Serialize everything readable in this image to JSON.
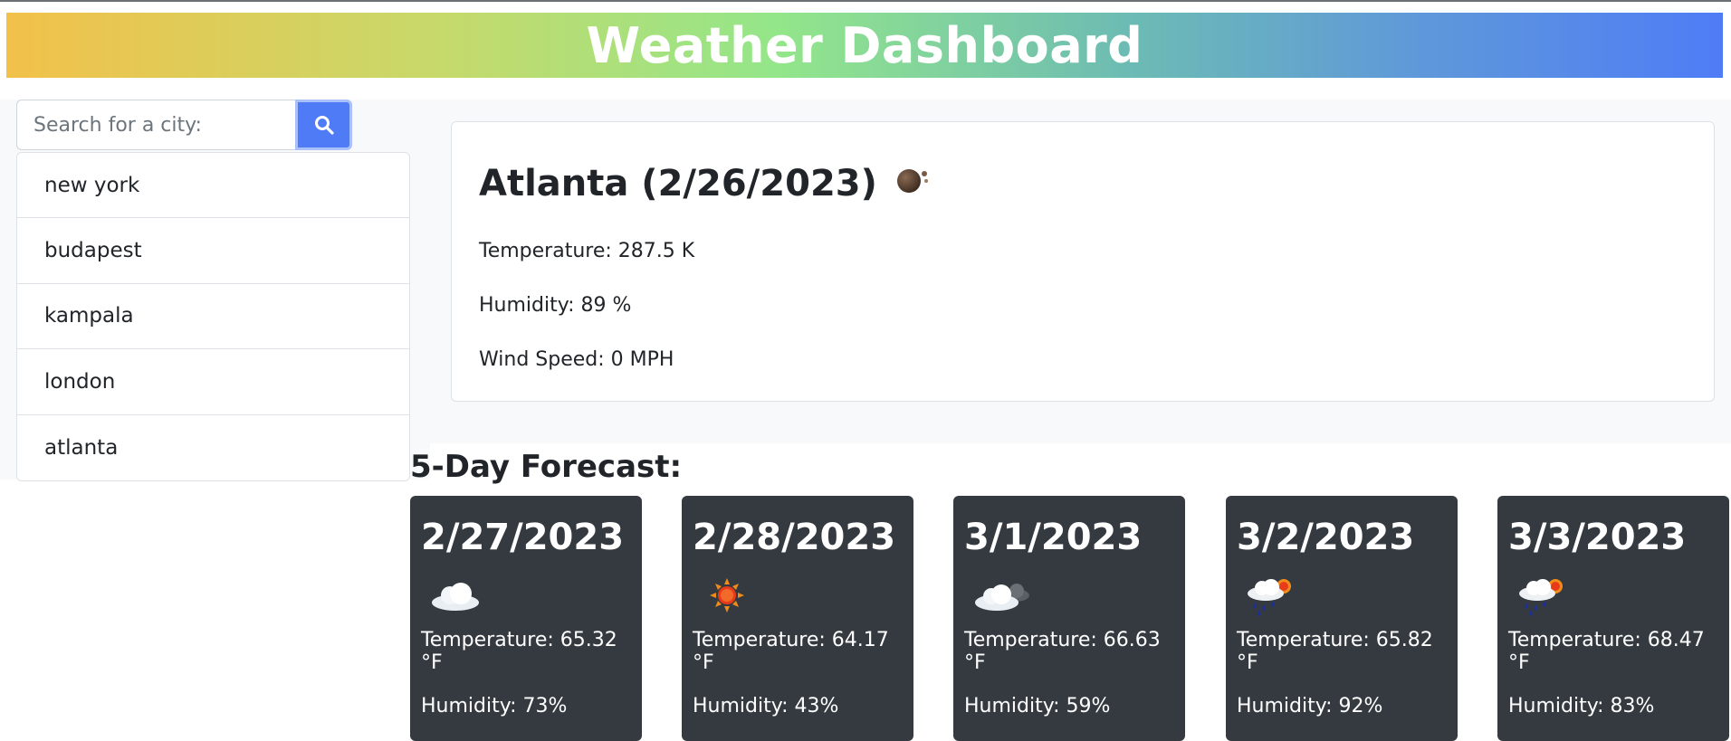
{
  "header": {
    "title": "Weather Dashboard"
  },
  "search": {
    "placeholder": "Search for a city:",
    "button_icon": "search-icon"
  },
  "history": [
    "new york",
    "budapest",
    "kampala",
    "london",
    "atlanta"
  ],
  "current": {
    "title": "Atlanta (2/26/2023)",
    "icon": "night-cloud-icon",
    "temperature": "Temperature: 287.5 K",
    "humidity": "Humidity: 89 %",
    "wind": "Wind Speed: 0 MPH"
  },
  "forecast": {
    "heading": "5-Day Forecast:",
    "days": [
      {
        "date": "2/27/2023",
        "icon": "cloud-icon",
        "temperature": "Temperature: 65.32 °F",
        "humidity": "Humidity: 73%"
      },
      {
        "date": "2/28/2023",
        "icon": "sun-icon",
        "temperature": "Temperature: 64.17 °F",
        "humidity": "Humidity: 43%"
      },
      {
        "date": "3/1/2023",
        "icon": "cloud-night-icon",
        "temperature": "Temperature: 66.63 °F",
        "humidity": "Humidity: 59%"
      },
      {
        "date": "3/2/2023",
        "icon": "rain-sun-icon",
        "temperature": "Temperature: 65.82 °F",
        "humidity": "Humidity: 92%"
      },
      {
        "date": "3/3/2023",
        "icon": "rain-sun-icon",
        "temperature": "Temperature: 68.47 °F",
        "humidity": "Humidity: 83%"
      }
    ]
  },
  "colors": {
    "accent": "#4f7cf6",
    "card_dark": "#343a40"
  }
}
